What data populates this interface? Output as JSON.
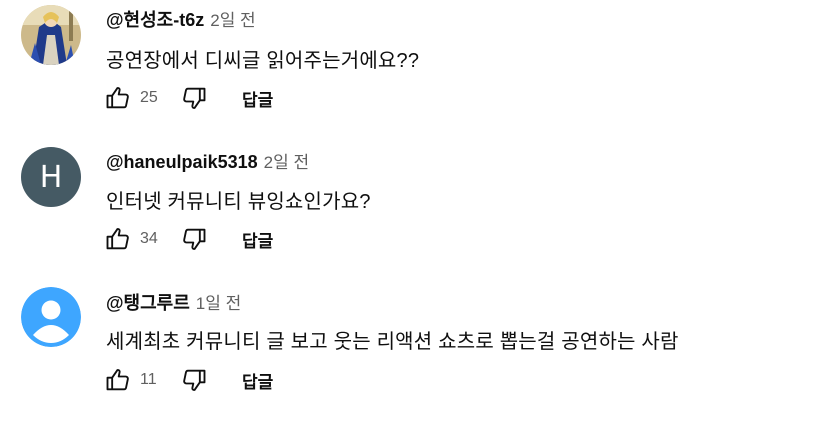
{
  "comments": [
    {
      "author": "@현성조-t6z",
      "time": "2일 전",
      "text": "공연장에서 디씨글 읽어주는거에요??",
      "likes": "25",
      "reply_label": "답글",
      "avatar": "image-avatar"
    },
    {
      "author": "@haneulpaik5318",
      "time": "2일 전",
      "text": "인터넷 커뮤니티 뷰잉쇼인가요?",
      "likes": "34",
      "reply_label": "답글",
      "avatar_letter": "H",
      "avatar_color": "#455a64"
    },
    {
      "author": "@탱그루르",
      "time": "1일 전",
      "text": "세계최초 커뮤니티 글 보고 웃는 리액션 쇼츠로 뽑는걸 공연하는 사람",
      "likes": "11",
      "reply_label": "답글",
      "avatar": "default-user-avatar",
      "avatar_color": "#3ea6ff"
    }
  ],
  "icons": {
    "like": "thumbs-up-icon",
    "dislike": "thumbs-down-icon"
  }
}
